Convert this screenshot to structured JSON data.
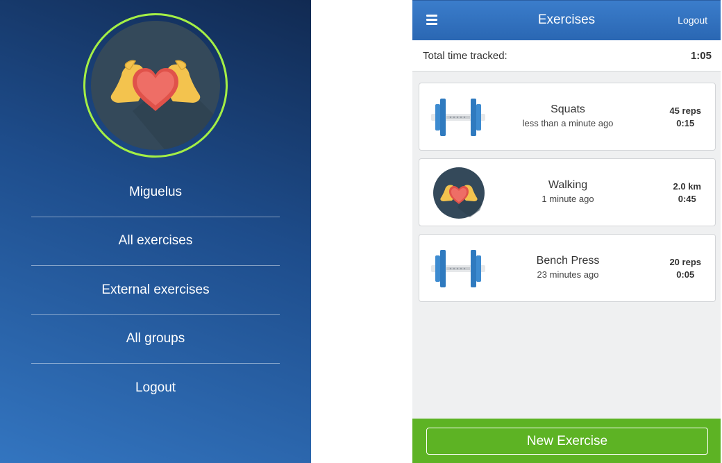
{
  "drawer": {
    "user_name": "Miguelus",
    "items": [
      {
        "label": "All exercises"
      },
      {
        "label": "External exercises"
      },
      {
        "label": "All groups"
      },
      {
        "label": "Logout"
      }
    ],
    "ring_color": "#a4ef45",
    "avatar_icon": "flexed-arms-heart-icon"
  },
  "header": {
    "title": "Exercises",
    "logout_label": "Logout",
    "menu_icon": "hamburger-menu-icon"
  },
  "summary": {
    "label": "Total time tracked:",
    "value": "1:05"
  },
  "exercises": [
    {
      "name": "Squats",
      "ago": "less than a minute ago",
      "amount": "45 reps",
      "duration": "0:15",
      "icon": "dumbbell-icon"
    },
    {
      "name": "Walking",
      "ago": "1 minute ago",
      "amount": "2.0 km",
      "duration": "0:45",
      "icon": "flexed-arms-heart-icon"
    },
    {
      "name": "Bench Press",
      "ago": "23 minutes ago",
      "amount": "20 reps",
      "duration": "0:05",
      "icon": "dumbbell-icon"
    }
  ],
  "footer": {
    "new_label": "New Exercise",
    "color": "#5db324"
  }
}
